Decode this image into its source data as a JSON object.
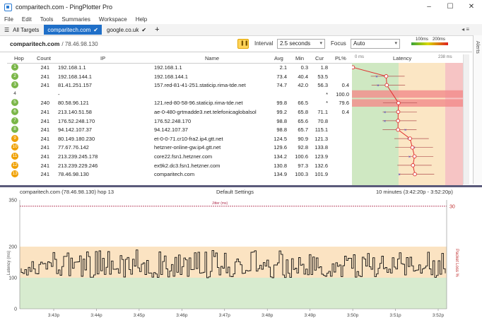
{
  "window": {
    "title": "comparitech.com - PingPlotter Pro",
    "buttons": [
      "–",
      "☐",
      "✕"
    ]
  },
  "menu": [
    "File",
    "Edit",
    "Tools",
    "Summaries",
    "Workspace",
    "Help"
  ],
  "tabs": [
    {
      "label": "All Targets",
      "active": false
    },
    {
      "label": "comparitech.com",
      "active": true
    },
    {
      "label": "google.co.uk",
      "active": false
    }
  ],
  "target": {
    "name": "comparitech.com",
    "ip": "/ 78.46.98.130"
  },
  "controls": {
    "interval_label": "Interval",
    "interval_value": "2.5 seconds",
    "focus_label": "Focus",
    "focus_value": "Auto",
    "scale_low": "100ms",
    "scale_high": "200ms"
  },
  "alerts_label": "Alerts",
  "table": {
    "headers": {
      "hop": "Hop",
      "count": "Count",
      "ip": "IP",
      "name": "Name",
      "avg": "Avg",
      "min": "Min",
      "cur": "Cur",
      "pl": "PL%",
      "latency_min": "0 ms",
      "latency": "Latency",
      "latency_max": "238 ms"
    },
    "rows": [
      {
        "hop": "1",
        "count": "241",
        "ip": "192.168.1.1",
        "name": "192.168.1.1",
        "avg": "2.1",
        "min": "0.3",
        "cur": "1.8",
        "pl": "",
        "color": "#7ab648"
      },
      {
        "hop": "2",
        "count": "241",
        "ip": "192.168.144.1",
        "name": "192.168.144.1",
        "avg": "73.4",
        "min": "40.4",
        "cur": "53.5",
        "pl": "",
        "color": "#7ab648"
      },
      {
        "hop": "3",
        "count": "241",
        "ip": "81.41.251.157",
        "name": "157.red-81-41-251.staticip.rima-tde.net",
        "avg": "74.7",
        "min": "42.0",
        "cur": "56.3",
        "pl": "0.4",
        "color": "#7ab648"
      },
      {
        "hop": "4",
        "count": "",
        "ip": "-",
        "name": "",
        "avg": "",
        "min": "",
        "cur": "*",
        "pl": "100.0",
        "color": ""
      },
      {
        "hop": "5",
        "count": "240",
        "ip": "80.58.96.121",
        "name": "121.red-80-58-96.staticip.rima-tde.net",
        "avg": "99.8",
        "min": "66.5",
        "cur": "*",
        "pl": "79.6",
        "color": "#7ab648"
      },
      {
        "hop": "6",
        "count": "241",
        "ip": "213.140.51.58",
        "name": "ae-0-480-grtmadde3.net.telefonicaglobalsol",
        "avg": "99.2",
        "min": "65.8",
        "cur": "71.1",
        "pl": "0.4",
        "color": "#7ab648"
      },
      {
        "hop": "7",
        "count": "241",
        "ip": "176.52.248.170",
        "name": "176.52.248.170",
        "avg": "98.8",
        "min": "65.6",
        "cur": "70.8",
        "pl": "",
        "color": "#7ab648"
      },
      {
        "hop": "8",
        "count": "241",
        "ip": "94.142.107.37",
        "name": "94.142.107.37",
        "avg": "98.8",
        "min": "65.7",
        "cur": "115.1",
        "pl": "",
        "color": "#7ab648"
      },
      {
        "hop": "9",
        "count": "241",
        "ip": "80.149.180.230",
        "name": "et-0-0-71.cr10-fra2.ip4.gtt.net",
        "avg": "124.5",
        "min": "90.9",
        "cur": "121.3",
        "pl": "",
        "color": "#f0a000"
      },
      {
        "hop": "10",
        "count": "241",
        "ip": "77.67.76.142",
        "name": "hetzner-online-gw.ip4.gtt.net",
        "avg": "129.6",
        "min": "92.8",
        "cur": "133.8",
        "pl": "",
        "color": "#f0a000"
      },
      {
        "hop": "11",
        "count": "241",
        "ip": "213.239.245.178",
        "name": "core22.fsn1.hetzner.com",
        "avg": "134.2",
        "min": "100.6",
        "cur": "123.9",
        "pl": "",
        "color": "#f0a000"
      },
      {
        "hop": "12",
        "count": "241",
        "ip": "213.239.229.246",
        "name": "ex9k2.dc3.fsn1.hetzner.com",
        "avg": "130.8",
        "min": "97.3",
        "cur": "132.6",
        "pl": "",
        "color": "#f0a000"
      },
      {
        "hop": "13",
        "count": "241",
        "ip": "78.46.98.130",
        "name": "comparitech.com",
        "avg": "134.9",
        "min": "100.3",
        "cur": "101.9",
        "pl": "",
        "color": "#f0a000"
      }
    ]
  },
  "graph": {
    "header_left": "comparitech.com (78.46.98.130) hop 13",
    "header_center": "Default Settings",
    "header_right": "10 minutes (3:42:20p - 3:52:20p)",
    "jitter_label": "Jitter (ms)",
    "y_left_label": "Latency (ms)",
    "y_right_label": "Packet Loss %",
    "y_ticks": [
      "350",
      "200",
      "100",
      "0"
    ],
    "right_tick": "30",
    "x_ticks": [
      "3:43p",
      "3:44p",
      "3:45p",
      "3:46p",
      "3:47p",
      "3:48p",
      "3:49p",
      "3:50p",
      "3:51p",
      "3:52p"
    ]
  }
}
